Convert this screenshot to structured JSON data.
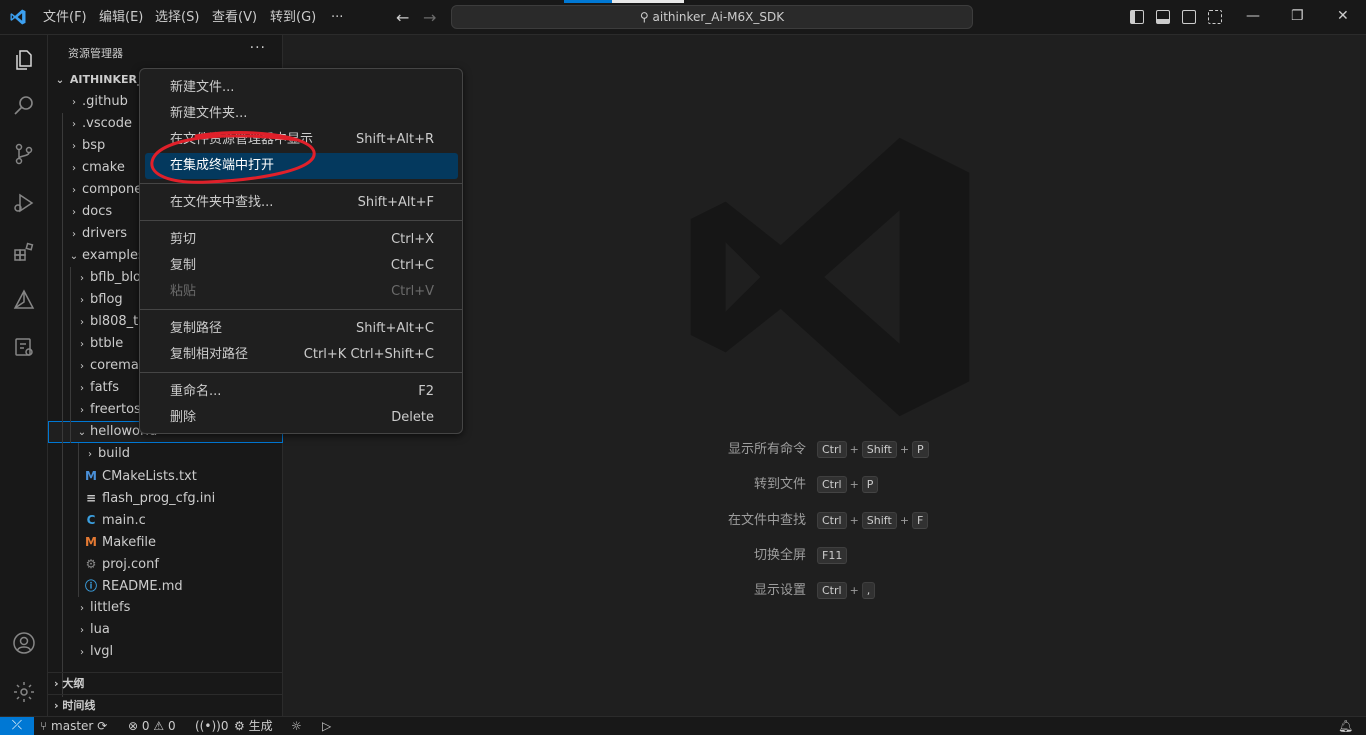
{
  "titlebar": {
    "menus": [
      "文件(F)",
      "编辑(E)",
      "选择(S)",
      "查看(V)",
      "转到(G)",
      "···"
    ],
    "search_text": "aithinker_Ai-M6X_SDK"
  },
  "explorer": {
    "header": "资源管理器",
    "more": "···",
    "root": "AITHINKER_A",
    "items": [
      {
        "label": ".github",
        "chev": "›"
      },
      {
        "label": ".vscode",
        "chev": "›"
      },
      {
        "label": "bsp",
        "chev": "›"
      },
      {
        "label": "cmake",
        "chev": "›"
      },
      {
        "label": "componen",
        "chev": "›"
      },
      {
        "label": "docs",
        "chev": "›"
      },
      {
        "label": "drivers",
        "chev": "›"
      },
      {
        "label": "examples",
        "chev": "⌄"
      },
      {
        "label": "bflb_bloc",
        "chev": "›"
      },
      {
        "label": "bflog",
        "chev": "›"
      },
      {
        "label": "bl808_tri",
        "chev": "›"
      },
      {
        "label": "btble",
        "chev": "›"
      },
      {
        "label": "coremark",
        "chev": "›"
      },
      {
        "label": "fatfs",
        "chev": "›"
      },
      {
        "label": "freertos",
        "chev": "›"
      },
      {
        "label": "helloworld",
        "chev": "⌄"
      },
      {
        "label": "build",
        "chev": "›"
      },
      {
        "label": "CMakeLists.txt",
        "icon": "M"
      },
      {
        "label": "flash_prog_cfg.ini",
        "icon": "≡"
      },
      {
        "label": "main.c",
        "icon": "C"
      },
      {
        "label": "Makefile",
        "icon": "M"
      },
      {
        "label": "proj.conf",
        "icon": "⚙"
      },
      {
        "label": "README.md",
        "icon": "ⓘ"
      },
      {
        "label": "littlefs",
        "chev": "›"
      },
      {
        "label": "lua",
        "chev": "›"
      },
      {
        "label": "lvgl",
        "chev": "›"
      }
    ],
    "outline": "大纲",
    "timeline": "时间线"
  },
  "context_menu": {
    "items": [
      {
        "label": "新建文件...",
        "shortcut": ""
      },
      {
        "label": "新建文件夹...",
        "shortcut": ""
      },
      {
        "label": "在文件资源管理器中显示",
        "shortcut": "Shift+Alt+R"
      },
      {
        "label": "在集成终端中打开",
        "shortcut": ""
      },
      {
        "label": "在文件夹中查找...",
        "shortcut": "Shift+Alt+F"
      },
      {
        "label": "剪切",
        "shortcut": "Ctrl+X"
      },
      {
        "label": "复制",
        "shortcut": "Ctrl+C"
      },
      {
        "label": "粘贴",
        "shortcut": "Ctrl+V"
      },
      {
        "label": "复制路径",
        "shortcut": "Shift+Alt+C"
      },
      {
        "label": "复制相对路径",
        "shortcut": "Ctrl+K Ctrl+Shift+C"
      },
      {
        "label": "重命名...",
        "shortcut": "F2"
      },
      {
        "label": "删除",
        "shortcut": "Delete"
      }
    ],
    "highlighted_index": 3,
    "disabled_index": 7
  },
  "welcome_hints": [
    {
      "label": "显示所有命令",
      "keys": [
        "Ctrl",
        "Shift",
        "P"
      ]
    },
    {
      "label": "转到文件",
      "keys": [
        "Ctrl",
        "P"
      ]
    },
    {
      "label": "在文件中查找",
      "keys": [
        "Ctrl",
        "Shift",
        "F"
      ]
    },
    {
      "label": "切换全屏",
      "keys": [
        "F11"
      ]
    },
    {
      "label": "显示设置",
      "keys": [
        "Ctrl",
        ","
      ]
    }
  ],
  "statusbar": {
    "branch": "master",
    "errors": "0",
    "warnings": "0",
    "ports": "0",
    "build": "生成"
  },
  "colors": {
    "accent": "#0078d4",
    "highlight": "#04395e",
    "annotation": "#e0202a"
  }
}
